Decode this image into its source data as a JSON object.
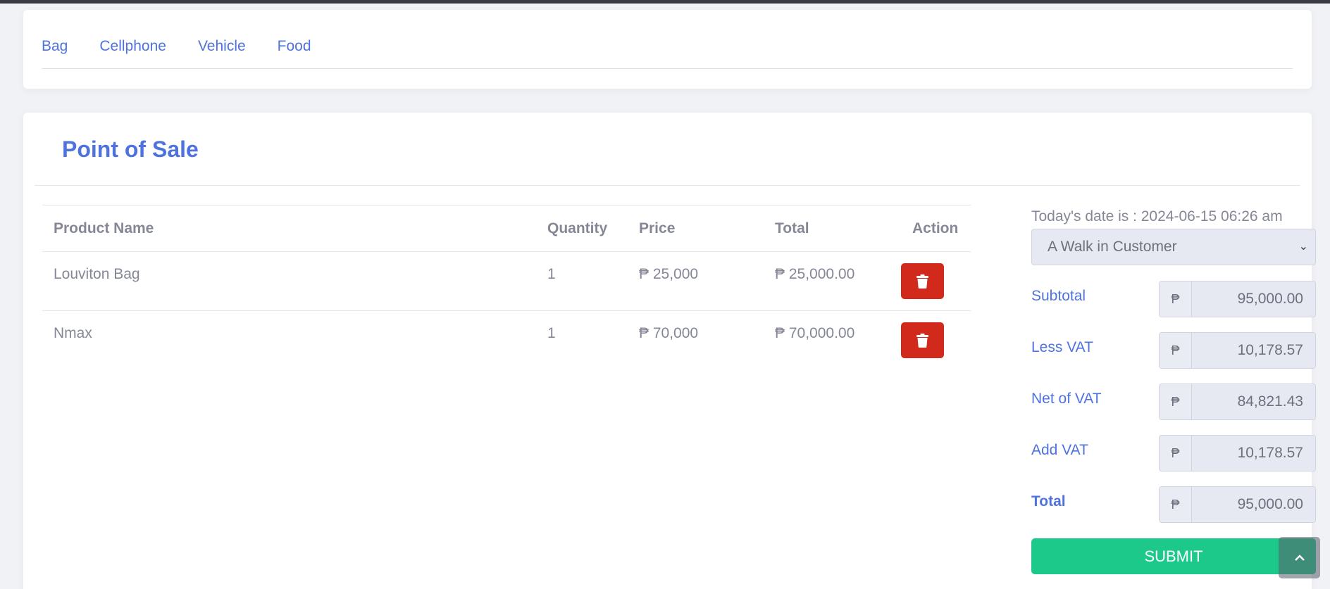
{
  "categories": [
    "Bag",
    "Cellphone",
    "Vehicle",
    "Food"
  ],
  "pos": {
    "title": "Point of Sale",
    "table": {
      "headers": [
        "Product Name",
        "Quantity",
        "Price",
        "Total",
        "Action"
      ],
      "rows": [
        {
          "name": "Louviton Bag",
          "qty": "1",
          "price": "₱ 25,000",
          "total": "₱ 25,000.00"
        },
        {
          "name": "Nmax",
          "qty": "1",
          "price": "₱ 70,000",
          "total": "₱ 70,000.00"
        }
      ]
    },
    "date_text": "Today's date is : 2024-06-15 06:26 am",
    "customer_select": "A Walk in Customer",
    "currency_symbol": "₱",
    "summary": {
      "subtotal_label": "Subtotal",
      "subtotal_value": "95,000.00",
      "less_vat_label": "Less VAT",
      "less_vat_value": "10,178.57",
      "net_vat_label": "Net of VAT",
      "net_vat_value": "84,821.43",
      "add_vat_label": "Add VAT",
      "add_vat_value": "10,178.57",
      "total_label": "Total",
      "total_value": "95,000.00"
    },
    "submit_label": "SUBMIT"
  },
  "colors": {
    "primary": "#4e73df",
    "danger": "#d2291d",
    "success": "#1cc88a"
  },
  "icons": {
    "delete": "trash-icon",
    "scroll_top": "chevron-up-icon",
    "select": "chevron-down-icon"
  }
}
